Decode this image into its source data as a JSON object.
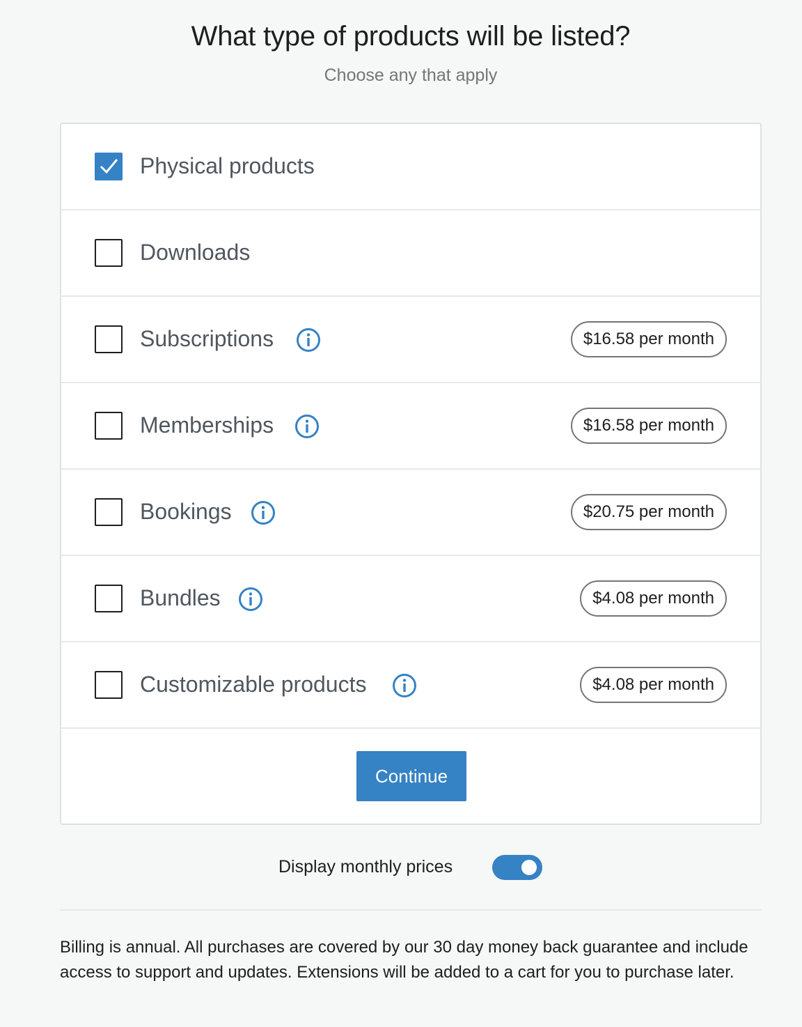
{
  "header": {
    "title": "What type of products will be listed?",
    "subtitle": "Choose any that apply"
  },
  "options": [
    {
      "label": "Physical products",
      "checked": true,
      "has_info": false,
      "price": ""
    },
    {
      "label": "Downloads",
      "checked": false,
      "has_info": false,
      "price": ""
    },
    {
      "label": "Subscriptions",
      "checked": false,
      "has_info": true,
      "price": "$16.58 per month"
    },
    {
      "label": "Memberships",
      "checked": false,
      "has_info": true,
      "price": "$16.58 per month"
    },
    {
      "label": "Bookings",
      "checked": false,
      "has_info": true,
      "price": "$20.75 per month"
    },
    {
      "label": "Bundles",
      "checked": false,
      "has_info": true,
      "price": "$4.08 per month"
    },
    {
      "label": "Customizable products",
      "checked": false,
      "has_info": true,
      "price": "$4.08 per month"
    }
  ],
  "actions": {
    "continue_label": "Continue"
  },
  "toggle": {
    "label": "Display monthly prices",
    "on": true
  },
  "footer": {
    "text": "Billing is annual. All purchases are covered by our 30 day money back guarantee and include access to support and updates. Extensions will be added to a cart for you to purchase later."
  },
  "colors": {
    "accent": "#3582c4",
    "background": "#f6f7f7",
    "label_text": "#50575e"
  },
  "icons": {
    "check": "checkmark-icon",
    "info": "info-icon"
  }
}
